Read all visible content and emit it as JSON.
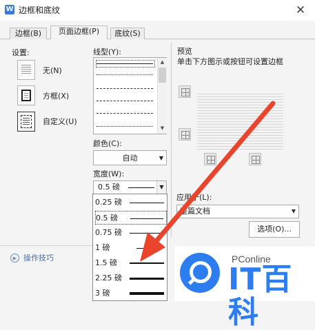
{
  "window": {
    "app_icon": "W",
    "title": "边框和底纹",
    "close_glyph": "✕"
  },
  "tabs": [
    {
      "label": "边框(B)"
    },
    {
      "label": "页面边框(P)"
    },
    {
      "label": "底纹(S)"
    }
  ],
  "settings": {
    "heading": "设置:",
    "items": [
      {
        "label": "无(N)"
      },
      {
        "label": "方框(X)"
      },
      {
        "label": "自定义(U)"
      }
    ]
  },
  "line_style": {
    "heading": "线型(Y):"
  },
  "color": {
    "heading": "颜色(C):",
    "value": "自动"
  },
  "width": {
    "heading": "宽度(W):",
    "value": "0.5   磅",
    "options": [
      {
        "label": "0.25 磅",
        "thickness": 1
      },
      {
        "label": "0.5   磅",
        "thickness": 1
      },
      {
        "label": "0.75 磅",
        "thickness": 1
      },
      {
        "label": "1      磅",
        "thickness": 1
      },
      {
        "label": "1.5   磅",
        "thickness": 2
      },
      {
        "label": "2.25 磅",
        "thickness": 3
      },
      {
        "label": "3      磅",
        "thickness": 4
      }
    ]
  },
  "preview": {
    "heading": "预览",
    "hint": "单击下方图示或按钮可设置边框"
  },
  "apply_to": {
    "heading": "应用于(L):",
    "value": "整篇文档"
  },
  "options_button": {
    "label": "选项(O)..."
  },
  "tips": {
    "label": "操作技巧"
  },
  "watermark": {
    "site": "PConline",
    "brand": "IT百科"
  },
  "colors": {
    "accent": "#2b7df0",
    "arrow": "#e8452c"
  }
}
